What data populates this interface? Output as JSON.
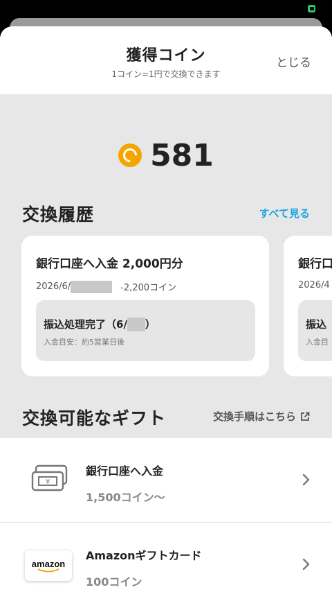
{
  "header": {
    "title": "獲得コイン",
    "subtitle": "1コイン=1円で交換できます",
    "close_label": "とじる"
  },
  "coins": {
    "amount": "581",
    "icon": "coin-icon",
    "accent_color": "#f6a500"
  },
  "history": {
    "title": "交換履歴",
    "see_all_label": "すべて見る",
    "link_color": "#1aa5e0",
    "cards": [
      {
        "title": "銀行口座へ入金 2,000円分",
        "date_prefix": "2026/6/",
        "amount": "-2,200コイン",
        "status_prefix": "振込処理完了（6/",
        "status_suffix": "）",
        "note": "入金目安：約5営業日後"
      },
      {
        "title": "銀行口",
        "date_prefix": "2026/4",
        "status_prefix": "振込",
        "note": "入金目"
      }
    ]
  },
  "gifts": {
    "title": "交換可能なギフト",
    "procedure_label": "交換手順はこちら",
    "items": [
      {
        "name": "銀行口座へ入金",
        "cost": "1,500コイン〜",
        "icon": "bank-transfer-icon"
      },
      {
        "name": "Amazonギフトカード",
        "cost": "100コイン",
        "icon": "amazon-logo",
        "logo_text": "amazon"
      }
    ]
  }
}
